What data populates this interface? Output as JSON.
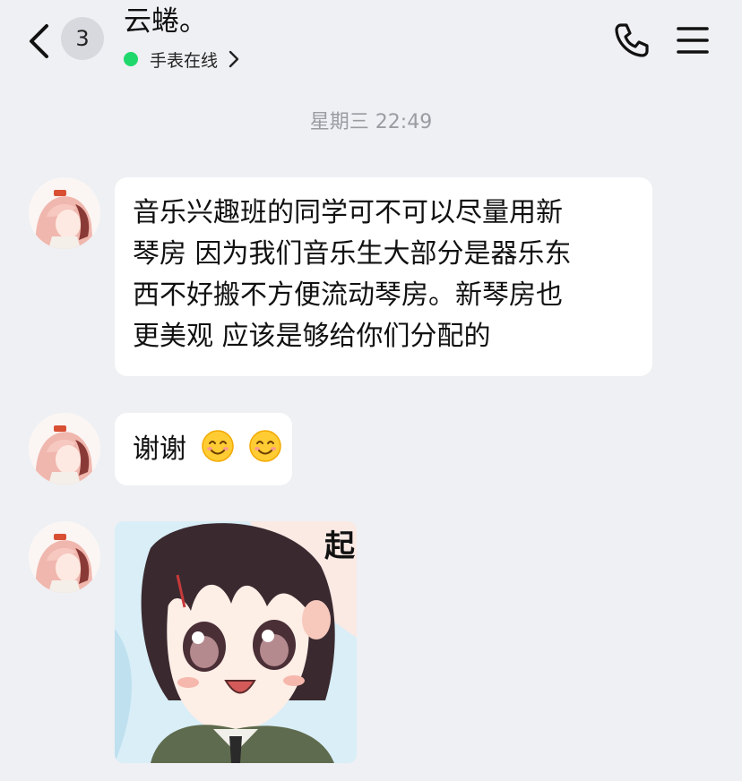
{
  "header": {
    "back_icon": "chevron-left-icon",
    "unread_count": "3",
    "contact_name": "云蜷。",
    "status_text": "手表在线",
    "status_color": "#1fd86b",
    "call_icon": "phone-icon",
    "menu_icon": "hamburger-menu-icon"
  },
  "chat": {
    "timestamp": "星期三 22:49",
    "messages": [
      {
        "type": "text",
        "lines": [
          "音乐兴趣班的同学可不可以尽量用新",
          "琴房 因为我们音乐生大部分是器乐东",
          "西不好搬不方便流动琴房。新琴房也",
          "更美观 应该是够给你们分配的"
        ]
      },
      {
        "type": "text",
        "text": "谢谢",
        "emoji": [
          "smiling-face-emoji",
          "smiling-face-emoji"
        ]
      },
      {
        "type": "sticker",
        "caption": "起"
      }
    ]
  },
  "colors": {
    "background": "#eef0f3",
    "bubble": "#ffffff",
    "badge": "#d7d9de",
    "timestamp": "#9a9ca2"
  }
}
